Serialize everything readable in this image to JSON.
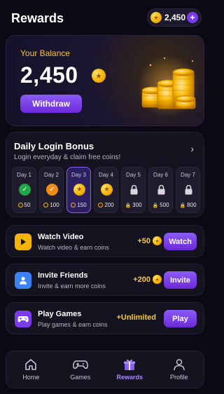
{
  "header": {
    "title": "Rewards",
    "balance": "2,450",
    "plus_symbol": "+"
  },
  "hero": {
    "label": "Your Balance",
    "value": "2,450",
    "withdraw_label": "Withdraw"
  },
  "daily_bonus": {
    "title": "Daily Login Bonus",
    "subtitle": "Login everyday & claim free coins!",
    "days": [
      {
        "label": "Day 1",
        "reward": "50",
        "state": "claimed"
      },
      {
        "label": "Day 2",
        "reward": "100",
        "state": "claimed"
      },
      {
        "label": "Day 3",
        "reward": "150",
        "state": "today"
      },
      {
        "label": "Day 4",
        "reward": "200",
        "state": "available"
      },
      {
        "label": "Day 5",
        "reward": "300",
        "state": "locked"
      },
      {
        "label": "Day 6",
        "reward": "500",
        "state": "locked"
      },
      {
        "label": "Day 7",
        "reward": "800",
        "state": "locked"
      }
    ]
  },
  "tasks": [
    {
      "title": "Watch Video",
      "subtitle": "Watch video & earn coins",
      "reward": "+50",
      "button": "Watch",
      "icon": "play-icon"
    },
    {
      "title": "Invite Friends",
      "subtitle": "Invite & earn more coins",
      "reward": "+200",
      "button": "Invite",
      "icon": "user-icon"
    },
    {
      "title": "Play Games",
      "subtitle": "Play games & earn coins",
      "reward": "+Unlimited",
      "button": "Play",
      "icon": "gamepad-icon"
    }
  ],
  "nav": [
    {
      "label": "Home",
      "icon": "home-icon"
    },
    {
      "label": "Games",
      "icon": "gamepad-icon"
    },
    {
      "label": "Rewards",
      "icon": "gift-icon",
      "active": true
    },
    {
      "label": "Profile",
      "icon": "profile-icon"
    }
  ],
  "colors": {
    "accent": "#7c3aed",
    "gold": "#f5c542",
    "background": "#0b0a14",
    "card": "#15131f"
  }
}
